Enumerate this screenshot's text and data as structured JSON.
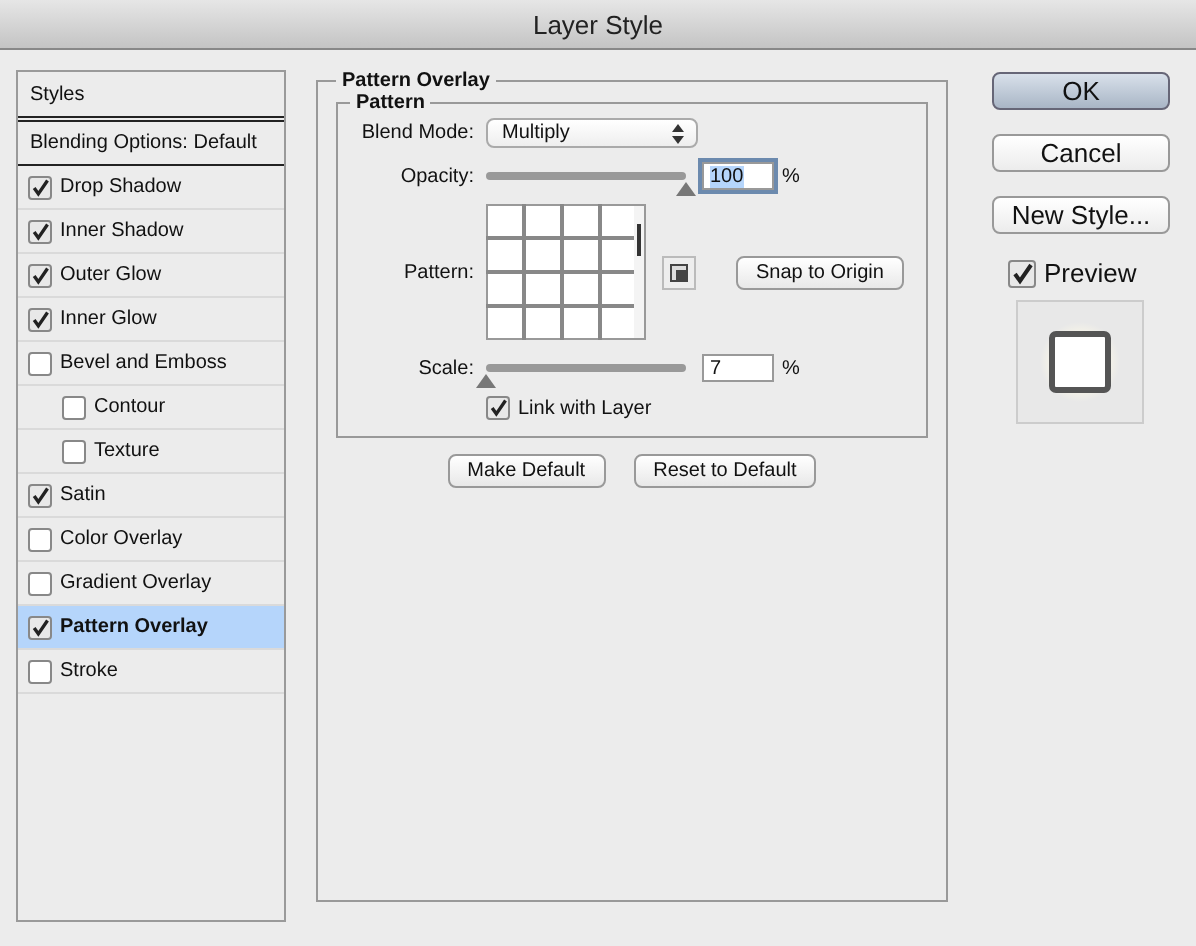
{
  "window": {
    "title": "Layer Style"
  },
  "styles": [
    {
      "kind": "header",
      "label": "Styles",
      "selected": false
    },
    {
      "kind": "header",
      "label": "Blending Options: Default",
      "selected": false
    },
    {
      "kind": "effect",
      "label": "Drop Shadow",
      "checked": true,
      "selected": false
    },
    {
      "kind": "effect",
      "label": "Inner Shadow",
      "checked": true,
      "selected": false
    },
    {
      "kind": "effect",
      "label": "Outer Glow",
      "checked": true,
      "selected": false
    },
    {
      "kind": "effect",
      "label": "Inner Glow",
      "checked": true,
      "selected": false
    },
    {
      "kind": "effect",
      "label": "Bevel and Emboss",
      "checked": false,
      "selected": false,
      "children": [
        {
          "kind": "effect",
          "label": "Contour",
          "checked": false,
          "selected": false
        },
        {
          "kind": "effect",
          "label": "Texture",
          "checked": false,
          "selected": false
        }
      ]
    },
    {
      "kind": "effect",
      "label": "Satin",
      "checked": true,
      "selected": false
    },
    {
      "kind": "effect",
      "label": "Color Overlay",
      "checked": false,
      "selected": false
    },
    {
      "kind": "effect",
      "label": "Gradient Overlay",
      "checked": false,
      "selected": false
    },
    {
      "kind": "effect",
      "label": "Pattern Overlay",
      "checked": true,
      "selected": true
    },
    {
      "kind": "effect",
      "label": "Stroke",
      "checked": false,
      "selected": false
    }
  ],
  "panel": {
    "title": "Pattern Overlay",
    "group": {
      "title": "Pattern",
      "blend_mode": {
        "label": "Blend Mode:",
        "value": "Multiply"
      },
      "opacity": {
        "label": "Opacity:",
        "level": 1.0,
        "value": "100",
        "unit": "%",
        "focused": true
      },
      "pattern": {
        "label": "Pattern:",
        "snap_button": "Snap to Origin"
      },
      "scale": {
        "label": "Scale:",
        "level": 0.0,
        "value": "7",
        "unit": "%",
        "focused": false
      },
      "link": {
        "label": "Link with Layer",
        "checked": true
      }
    },
    "buttons": [
      "Make Default",
      "Reset to Default"
    ]
  },
  "actions": [
    {
      "label": "OK",
      "default": true
    },
    {
      "label": "Cancel",
      "default": false
    },
    {
      "label": "New Style...",
      "default": false
    }
  ],
  "preview": {
    "label": "Preview",
    "checked": true
  }
}
